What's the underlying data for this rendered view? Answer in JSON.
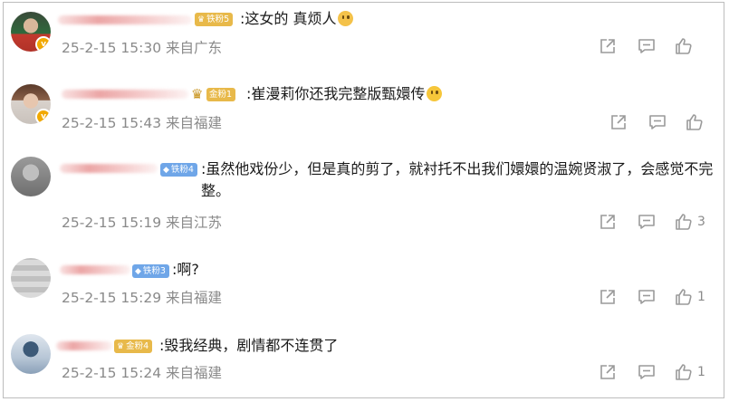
{
  "comments": [
    {
      "fan_badge": "铁粉5",
      "badge_style": "gold",
      "text": ":这女的 真烦人",
      "emoji": "crying-face",
      "time": "25-2-15 15:30",
      "location": "来自广东",
      "like_count": ""
    },
    {
      "fan_badge": "金粉1",
      "badge_style": "gold",
      "text": ":崔漫莉你还我完整版甄嬛传",
      "emoji": "smiling-face",
      "time": "25-2-15 15:43",
      "location": "来自福建",
      "like_count": ""
    },
    {
      "fan_badge": "铁粉4",
      "badge_style": "blue",
      "text": ":虽然他戏份少，但是真的剪了，就衬托不出我们嬛嬛的温婉贤淑了，会感觉不完整。",
      "time": "25-2-15 15:19",
      "location": "来自江苏",
      "like_count": "3"
    },
    {
      "fan_badge": "铁粉3",
      "badge_style": "blue",
      "text": ":啊?",
      "time": "25-2-15 15:29",
      "location": "来自福建",
      "like_count": "1"
    },
    {
      "fan_badge": "金粉4",
      "badge_style": "gold",
      "text": ":毁我经典，剧情都不连贯了",
      "time": "25-2-15 15:24",
      "location": "来自福建",
      "like_count": "1"
    }
  ],
  "icons": {
    "share": "share-icon",
    "comment": "comment-icon",
    "like": "thumbs-up-icon",
    "verified": "verified-badge-icon"
  },
  "colors": {
    "meta_gray": "#8a8a8a",
    "fan_blue": "#6fa6e8",
    "fan_gold": "#e8b94a",
    "verified_orange": "#f2a900"
  }
}
